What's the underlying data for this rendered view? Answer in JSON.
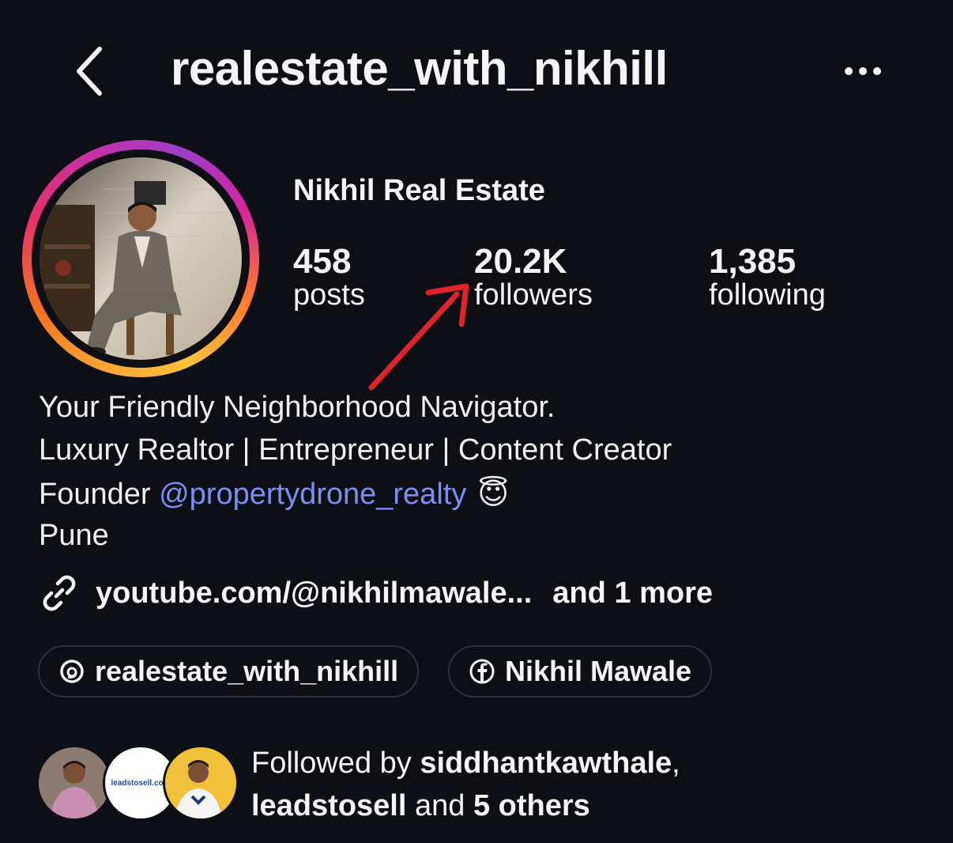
{
  "header": {
    "back_icon": "chevron-left-icon",
    "username": "realestate_with_nikhill",
    "more_icon": "ellipsis-icon"
  },
  "profile": {
    "display_name": "Nikhil Real Estate",
    "stats": [
      {
        "value": "458",
        "label": "posts"
      },
      {
        "value": "20.2K",
        "label": "followers"
      },
      {
        "value": "1,385",
        "label": "following"
      }
    ]
  },
  "bio": {
    "line1": "Your Friendly Neighborhood Navigator.",
    "line2": "Luxury Realtor | Entrepreneur | Content Creator",
    "line3_prefix": "Founder ",
    "line3_mention": "@propertydrone_realty",
    "line3_emoji": "😇",
    "line4": "Pune"
  },
  "link": {
    "icon": "link-icon",
    "url": "youtube.com/@nikhilmawale...",
    "more": "and 1 more"
  },
  "chips": [
    {
      "icon": "threads-icon",
      "label": "realestate_with_nikhill"
    },
    {
      "icon": "facebook-icon",
      "label": "Nikhil Mawale"
    }
  ],
  "followed_by": {
    "prefix": "Followed by ",
    "user1": "siddhantkawthale",
    "sep": ",",
    "user2": "leadstosell",
    "and": " and ",
    "others": "5 others",
    "avatar2_text": "leadstosell.com"
  },
  "colors": {
    "background": "#0d0f14",
    "mention": "#7a8ff5",
    "annotation_arrow": "#e0232b"
  }
}
